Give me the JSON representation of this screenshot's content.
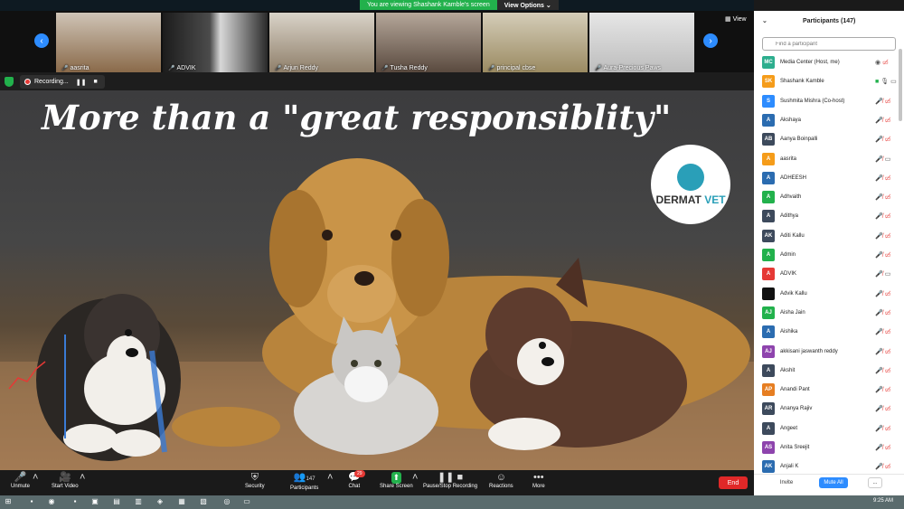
{
  "banner": {
    "message": "You are viewing Shashank Kamble's screen",
    "options_label": "View Options ⌄"
  },
  "view_label": "View",
  "thumbnails": [
    "aasrita",
    "ADVIK",
    "Arjun Reddy",
    "Tusha Reddy",
    "principal cbse",
    "Aura-Precious Paws"
  ],
  "recording": {
    "label": "Recording..."
  },
  "slide": {
    "title": "More than a \"great responsiblity\"",
    "logo_text_1": "DERMAT",
    "logo_text_2": "VET"
  },
  "toolbar": {
    "unmute": "Unmute",
    "start_video": "Start Video",
    "security": "Security",
    "participants": "Participants",
    "participants_count": "147",
    "chat": "Chat",
    "chat_badge": "29",
    "share_screen": "Share Screen",
    "record": "Pause/Stop Recording",
    "reactions": "Reactions",
    "more": "More",
    "end": "End"
  },
  "panel": {
    "title": "Participants (147)",
    "search_placeholder": "Find a participant",
    "invite": "Invite",
    "mute_all": "Mute All",
    "more": "..."
  },
  "participants": [
    {
      "initials": "MC",
      "name": "Media Center (Host, me)",
      "color": "#2dae8e",
      "state": "host"
    },
    {
      "initials": "SK",
      "name": "Shashank Kamble",
      "color": "#f59c1a",
      "state": "sharing"
    },
    {
      "initials": "S",
      "name": "Sushmita Mishra (Co-host)",
      "color": "#2d8cff",
      "state": "off"
    },
    {
      "initials": "A",
      "name": "Akshaya",
      "color": "#2b6cb0",
      "state": "off"
    },
    {
      "initials": "AB",
      "name": "Aanya Boinpalli",
      "color": "#3d4a5c",
      "state": "off"
    },
    {
      "initials": "A",
      "name": "aasrita",
      "color": "#f59c1a",
      "state": "video"
    },
    {
      "initials": "A",
      "name": "ADHEESH",
      "color": "#2b6cb0",
      "state": "off"
    },
    {
      "initials": "A",
      "name": "Adhvaith",
      "color": "#22b14c",
      "state": "off"
    },
    {
      "initials": "A",
      "name": "Adithya",
      "color": "#3d4a5c",
      "state": "off"
    },
    {
      "initials": "AK",
      "name": "Aditi Kallu",
      "color": "#3d4a5c",
      "state": "off"
    },
    {
      "initials": "A",
      "name": "Admin",
      "color": "#22b14c",
      "state": "off"
    },
    {
      "initials": "A",
      "name": "ADVIK",
      "color": "#e53935",
      "state": "video"
    },
    {
      "initials": "",
      "name": "Advik Kallu",
      "color": "#111111",
      "state": "off"
    },
    {
      "initials": "AJ",
      "name": "Aisha Jain",
      "color": "#22b14c",
      "state": "off"
    },
    {
      "initials": "A",
      "name": "Aishika",
      "color": "#2b6cb0",
      "state": "off"
    },
    {
      "initials": "AJ",
      "name": "akkisani jaswanth reddy",
      "color": "#8e44ad",
      "state": "off"
    },
    {
      "initials": "A",
      "name": "Akshit",
      "color": "#3d4a5c",
      "state": "off"
    },
    {
      "initials": "AP",
      "name": "Anandi Pant",
      "color": "#e67e22",
      "state": "off"
    },
    {
      "initials": "AR",
      "name": "Ananya Rajiv",
      "color": "#3d4a5c",
      "state": "off"
    },
    {
      "initials": "A",
      "name": "Angeet",
      "color": "#3d4a5c",
      "state": "off"
    },
    {
      "initials": "AS",
      "name": "Anita Sreejit",
      "color": "#8e44ad",
      "state": "off"
    },
    {
      "initials": "AK",
      "name": "Anjali K",
      "color": "#2b6cb0",
      "state": "off"
    }
  ],
  "taskbar": {
    "time": "9:25 AM"
  },
  "colors": {
    "accent": "#2d8cff",
    "success": "#22b14c",
    "danger": "#e53935"
  }
}
